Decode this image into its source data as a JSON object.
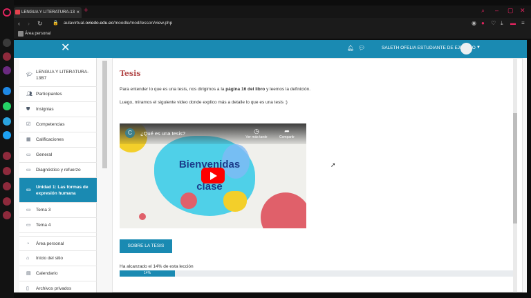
{
  "browser": {
    "tab_title": "LENGUA Y LITERATURA-13",
    "new_tab": "+",
    "tab_close": "×",
    "url_prefix": "aulavirtual.",
    "url_host": "oviedo.edu.ec",
    "url_path": "/moodle/mod/lesson/view.php",
    "bookmark": "Área personal"
  },
  "navbar": {
    "close_glyph": "✕",
    "user_name": "SALETH OFELIA ESTUDIANTE DE EJEMPLO",
    "caret": "▼"
  },
  "sidebar": {
    "items": [
      {
        "label": "LENGUA Y LITERATURA-13B7",
        "icon": "graduation-cap-icon"
      },
      {
        "label": "Participantes",
        "icon": "users-icon"
      },
      {
        "label": "Insignias",
        "icon": "shield-icon"
      },
      {
        "label": "Competencias",
        "icon": "checkbox-icon"
      },
      {
        "label": "Calificaciones",
        "icon": "table-icon"
      },
      {
        "label": "General",
        "icon": "folder-icon"
      },
      {
        "label": "Diagnóstico y refuerzo",
        "icon": "folder-icon"
      },
      {
        "label": "Unidad 1: Las formas de expresión humana",
        "icon": "folder-icon"
      },
      {
        "label": "Tema 3",
        "icon": "folder-icon"
      },
      {
        "label": "Tema 4",
        "icon": "folder-icon"
      },
      {
        "label": "Área personal",
        "icon": "dashboard-icon"
      },
      {
        "label": "Inicio del sitio",
        "icon": "home-icon"
      },
      {
        "label": "Calendario",
        "icon": "calendar-icon"
      },
      {
        "label": "Archivos privados",
        "icon": "file-icon"
      }
    ]
  },
  "lesson": {
    "title": "Tesis",
    "p1_before": "Para entender lo que es una tesis, nos dirigimos a la ",
    "p1_bold": "página 16 del libro",
    "p1_after": " y leemos la definición.",
    "p2": "Luego, miramos el siguiente video donde explico más a detalle lo que es una tesis :)",
    "video": {
      "channel_initial": "C",
      "title": "¿Qué es una tesis?",
      "watch_later": "Ver más tarde",
      "share": "Compartir",
      "overlay_line1": "Bienvenidas",
      "overlay_line2": "clase"
    },
    "button": "SOBRE LA TESIS",
    "progress_label": "Ha alcanzado el 14% de esta lección",
    "progress_value": 14,
    "progress_text": "14%"
  },
  "colors": {
    "accent": "#1a8ab2",
    "title": "#b34a4a",
    "browser_accent": "#e0245e"
  }
}
